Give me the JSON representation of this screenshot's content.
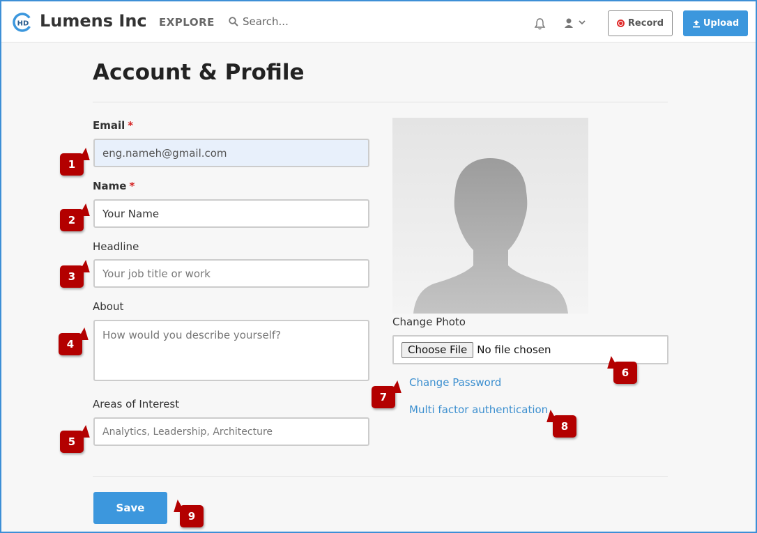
{
  "header": {
    "brand": "Lumens Inc",
    "logo_text": "HD",
    "explore": "EXPLORE",
    "search_placeholder": "Search...",
    "record_label": "Record",
    "upload_label": "Upload"
  },
  "page": {
    "title": "Account & Profile"
  },
  "form": {
    "email_label": "Email",
    "email_value": "eng.nameh@gmail.com",
    "name_label": "Name",
    "name_value": "Your Name",
    "headline_label": "Headline",
    "headline_placeholder": "Your job title or work",
    "about_label": "About",
    "about_placeholder": "How would you describe yourself?",
    "interests_label": "Areas of Interest",
    "interests_placeholder": "Analytics, Leadership, Architecture",
    "required_mark": "*",
    "save_label": "Save"
  },
  "photo": {
    "change_photo_label": "Change Photo",
    "choose_file_label": "Choose File",
    "no_file_text": "No file chosen"
  },
  "links": {
    "change_password": "Change Password",
    "mfa": "Multi factor authentication"
  },
  "callouts": [
    "1",
    "2",
    "3",
    "4",
    "5",
    "6",
    "7",
    "8",
    "9"
  ],
  "colors": {
    "accent": "#3c97dd",
    "callout": "#b30000",
    "required": "#d42020",
    "link": "#3c8fcf",
    "frame": "#3d8fd6"
  }
}
